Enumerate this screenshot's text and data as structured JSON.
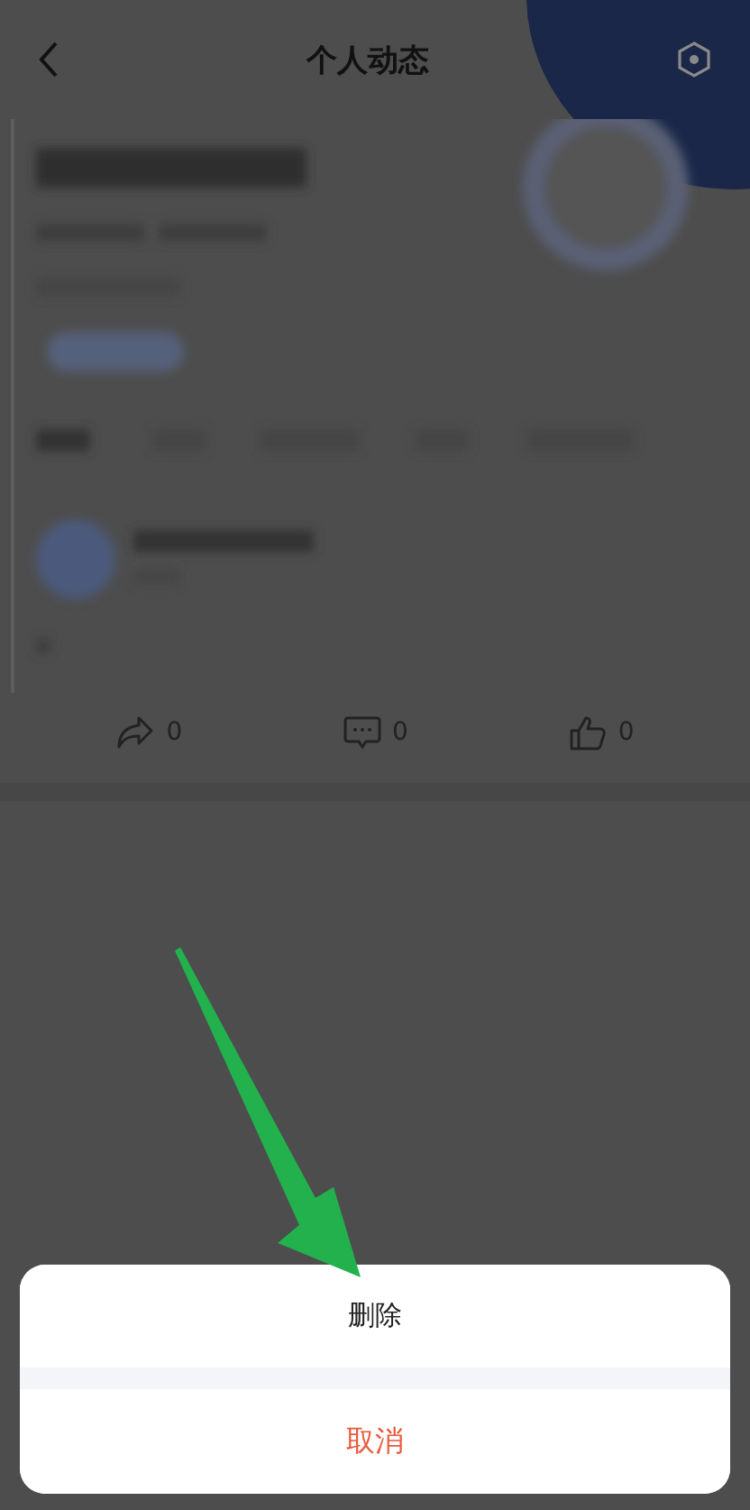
{
  "header": {
    "title": "个人动态"
  },
  "actions": [
    {
      "kind": "share",
      "count": "0"
    },
    {
      "kind": "comment",
      "count": "0"
    },
    {
      "kind": "like",
      "count": "0"
    }
  ],
  "action_sheet": {
    "options": [
      {
        "label": "删除",
        "kind": "normal"
      },
      {
        "label": "取消",
        "kind": "cancel"
      }
    ]
  }
}
